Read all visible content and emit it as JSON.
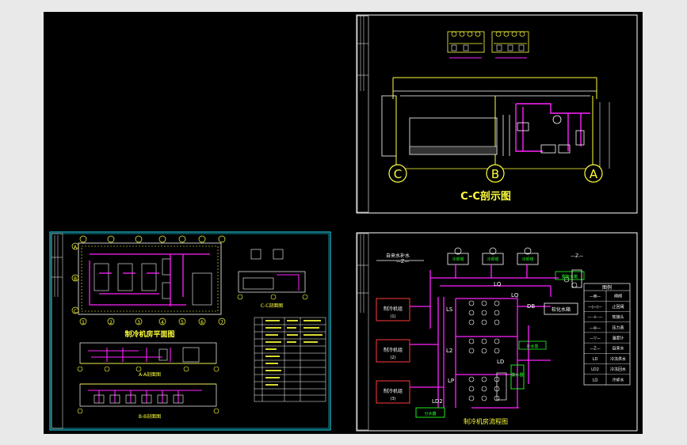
{
  "colors": {
    "background": "#000000",
    "frame": "#ffffff",
    "yellow": "#ffff3c",
    "magenta": "#ff22ff",
    "cyan": "#22e6ff",
    "red": "#ff3a3a",
    "green": "#25ff25"
  },
  "section_view": {
    "title": "C-C剖示图",
    "axes": [
      "C",
      "B",
      "A"
    ]
  },
  "plan_sheet": {
    "plan_title": "制冷机房平面图",
    "section_a_title": "A-A剖面图",
    "section_b_title": "B-B剖面图",
    "detail_title": "C-C剖面图",
    "grid_letters_left": [
      "A",
      "B",
      "C"
    ],
    "grid_numbers": [
      "1",
      "2",
      "3",
      "4",
      "5",
      "6",
      "7"
    ]
  },
  "flow_sheet": {
    "title": "制冷机房流程图",
    "chillers": [
      {
        "label": "制冷机组",
        "sub": "(1)"
      },
      {
        "label": "制冷机组",
        "sub": "(2)"
      },
      {
        "label": "制冷机组",
        "sub": "(3)"
      }
    ],
    "cooling_tower_label": "冷却塔",
    "boxes": {
      "collector": "集水器",
      "distributor": "分水器",
      "softener": "软化水箱",
      "expansion": "膨胀水箱",
      "makeup": "补水泵"
    },
    "pipe_labels": [
      "LQ",
      "LQ",
      "DB",
      "LD",
      "LS",
      "L2",
      "LD2",
      "LP"
    ],
    "texts": {
      "water_supply": "自来水补水",
      "drain_left": "—Z—",
      "drain_right": "—Z—"
    },
    "legend": {
      "title": "图例",
      "items": [
        {
          "symbol": "—⊠—",
          "name": "闸阀"
        },
        {
          "symbol": "—▷◁—",
          "name": "止回阀"
        },
        {
          "symbol": "—⊣⊢—",
          "name": "软接头"
        },
        {
          "symbol": "—◎—",
          "name": "压力表"
        },
        {
          "symbol": "—▽—",
          "name": "温度计"
        },
        {
          "symbol": "—Z—",
          "name": "自来水"
        },
        {
          "symbol": "LD",
          "name": "冷冻供水"
        },
        {
          "symbol": "LD2",
          "name": "冷冻回水"
        },
        {
          "symbol": "LQ",
          "name": "冷却水"
        }
      ]
    }
  }
}
